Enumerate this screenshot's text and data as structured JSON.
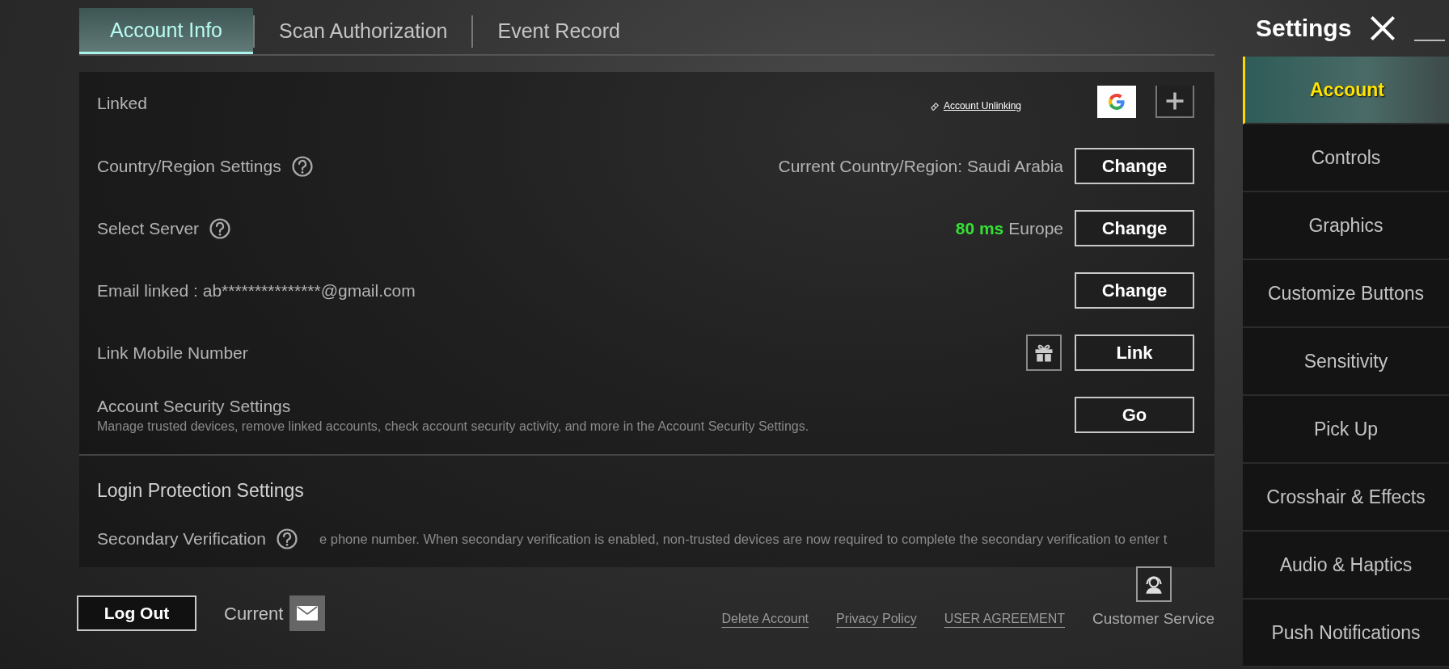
{
  "tabs": [
    {
      "label": "Account Info",
      "selected": true
    },
    {
      "label": "Scan Authorization",
      "selected": false
    },
    {
      "label": "Event Record",
      "selected": false
    }
  ],
  "settings": {
    "title": "Settings"
  },
  "sidebar": {
    "items": [
      {
        "label": "Account",
        "selected": true
      },
      {
        "label": "Controls",
        "selected": false
      },
      {
        "label": "Graphics",
        "selected": false
      },
      {
        "label": "Customize Buttons",
        "selected": false
      },
      {
        "label": "Sensitivity",
        "selected": false
      },
      {
        "label": "Pick Up",
        "selected": false
      },
      {
        "label": "Crosshair & Effects",
        "selected": false
      },
      {
        "label": "Audio & Haptics",
        "selected": false
      },
      {
        "label": "Push Notifications",
        "selected": false
      }
    ]
  },
  "linked": {
    "label": "Linked",
    "unlink_link": "Account Unlinking",
    "accounts": [
      {
        "kind": "google"
      },
      {
        "kind": "add"
      }
    ]
  },
  "rows": [
    {
      "label": "Country/Region Settings",
      "help": true,
      "value": "Current Country/Region: Saudi Arabia",
      "button": "Change"
    },
    {
      "label": "Select Server",
      "help": true,
      "ping": "80 ms",
      "value": "Europe",
      "button": "Change"
    },
    {
      "label": "Email linked : ab***************@gmail.com",
      "button": "Change"
    },
    {
      "label": "Link Mobile Number",
      "gift": true,
      "button": "Link"
    },
    {
      "label": "Account Security Settings",
      "description": "Manage trusted devices, remove linked accounts, check account security activity, and more in the Account Security Settings.",
      "button": "Go"
    }
  ],
  "login_protection": {
    "title": "Login Protection Settings",
    "items": [
      {
        "label": "Secondary Verification",
        "help": true,
        "scrolling_text": "e phone number. When secondary verification is enabled, non-trusted devices are now required to complete the secondary verification to enter t"
      }
    ]
  },
  "footer": {
    "logout": "Log Out",
    "current": "Current",
    "links": [
      "Delete Account",
      "Privacy Policy",
      "USER AGREEMENT"
    ],
    "customer_service": "Customer Service"
  }
}
